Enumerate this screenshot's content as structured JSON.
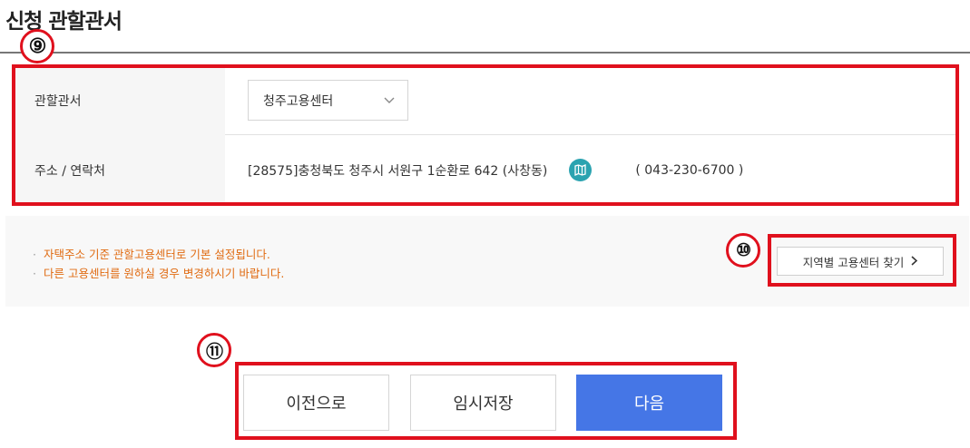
{
  "section": {
    "title": "신청 관할관서"
  },
  "annotations": {
    "n9": "⑨",
    "n10": "⑩",
    "n11": "⑪"
  },
  "form": {
    "office_label": "관할관서",
    "office_selected": "청주고용센터",
    "address_label": "주소 / 연락처",
    "address": "[28575]충청북도 청주시 서원구 1순환로 642 (사창동)",
    "map_icon": "map-icon",
    "phone": "( 043-230-6700 )"
  },
  "notice": {
    "items": [
      "자택주소 기준 관할고용센터로 기본 설정됩니다.",
      "다른 고용센터를 원하실 경우 변경하시기 바랍니다."
    ]
  },
  "region_search": {
    "label": "지역별 고용센터 찾기"
  },
  "actions": {
    "prev_label": "이전으로",
    "temp_save_label": "임시저장",
    "next_label": "다음"
  },
  "colors": {
    "accent_blue": "#4576e6",
    "annotation_red": "#e0101d",
    "notice_orange": "#e06b12",
    "map_teal": "#2ba3b0"
  }
}
